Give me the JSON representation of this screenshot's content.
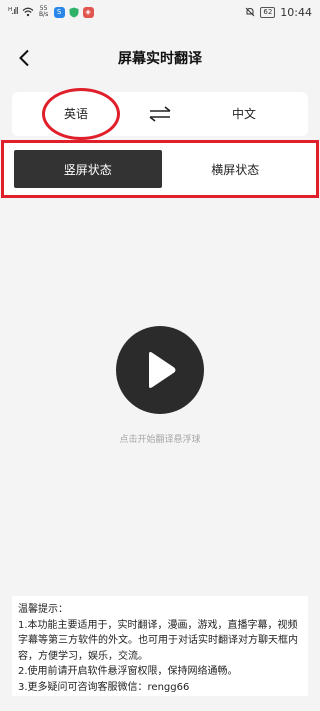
{
  "status_bar": {
    "signal": "ᴴ.ıll",
    "speed_value": "55",
    "speed_unit": "B/s",
    "app_icon_1": "S",
    "app_icon_2": "◈",
    "battery": "62",
    "time": "10:44",
    "colors": {
      "app1": "#2a86e8",
      "app2": "#2fb36a",
      "app3": "#e0554f"
    },
    "icons": [
      "wifi-icon",
      "shield-icon",
      "mute-icon",
      "battery-icon"
    ]
  },
  "header": {
    "title": "屏幕实时翻译",
    "back_icon": "chevron-left-icon"
  },
  "language": {
    "source": "英语",
    "target": "中文",
    "swap_icon": "swap-arrows-icon"
  },
  "modes": {
    "portrait": "竖屏状态",
    "landscape": "横屏状态",
    "active": "portrait",
    "active_color": "#333333"
  },
  "play": {
    "icon": "play-icon",
    "hint": "点击开始翻译悬浮球"
  },
  "tips": {
    "heading": "温馨提示：",
    "line1": "1.本功能主要适用于，实时翻译，漫画，游戏，直播字幕，视频字幕等第三方软件的外文。也可用于对话实时翻译对方聊天框内容，方便学习，娱乐，交流。",
    "line2": "2.使用前请开启软件悬浮窗权限，保持网络通畅。",
    "line3": "3.更多疑问可咨询客服微信：rengg66"
  },
  "annotation_color": "#e01f2a"
}
